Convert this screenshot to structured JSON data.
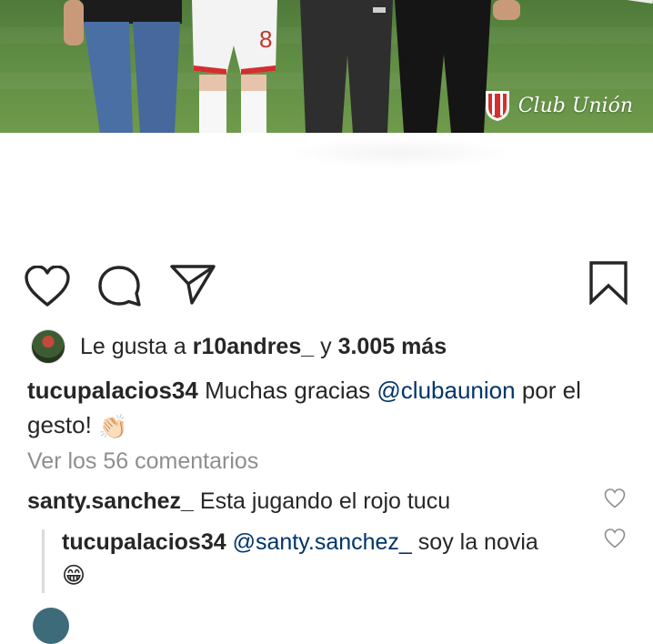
{
  "post_image": {
    "brand_text": "Club Unión",
    "jersey_number": "8"
  },
  "actions": {
    "like": "heart-icon",
    "comment": "comment-icon",
    "share": "paper-plane-icon",
    "save": "bookmark-icon"
  },
  "likes": {
    "prefix": "Le gusta a",
    "user": "r10andres_",
    "joiner": "y",
    "others": "3.005 más"
  },
  "caption": {
    "username": "tucupalacios34",
    "text_before": "Muchas gracias",
    "mention": "@clubaunion",
    "text_after": "por el gesto!",
    "emoji": "👏🏻"
  },
  "view_all": "Ver los 56 comentarios",
  "comments": [
    {
      "username": "santy.sanchez_",
      "text": "Esta jugando el rojo tucu"
    },
    {
      "username": "tucupalacios34",
      "mention": "@santy.sanchez_",
      "text": "soy la novia",
      "emoji": "😁"
    }
  ],
  "colors": {
    "text": "#262626",
    "muted": "#8e8e8e",
    "mention": "#003569",
    "accent_red": "#d32f2f"
  }
}
